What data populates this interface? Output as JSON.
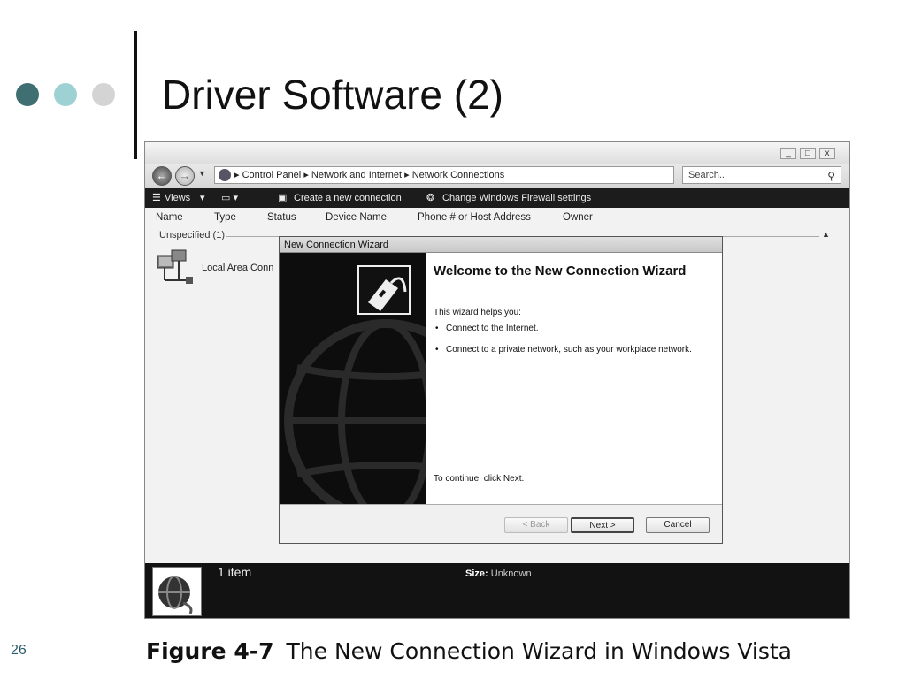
{
  "slide": {
    "title": "Driver Software (2)",
    "number": "26",
    "caption_label": "Figure 4-7",
    "caption_text": "The New Connection Wizard in Windows Vista"
  },
  "window": {
    "controls": {
      "minimize": "_",
      "maximize": "□",
      "close": "x"
    },
    "nav": {
      "back": "←",
      "forward": "→"
    },
    "breadcrumb": [
      "Control Panel",
      "Network and Internet",
      "Network Connections"
    ],
    "breadcrumb_sep": "▸",
    "search_placeholder": "Search...",
    "toolbar": {
      "views": "Views",
      "create_connection": "Create a new connection",
      "firewall": "Change Windows Firewall settings"
    },
    "columns": [
      "Name",
      "Type",
      "Status",
      "Device Name",
      "Phone # or Host Address",
      "Owner"
    ],
    "group_label": "Unspecified (1)",
    "item_label": "Local Area Conn",
    "status": {
      "count": "1 item",
      "size_label": "Size:",
      "size_value": "Unknown"
    }
  },
  "wizard": {
    "title": "New Connection Wizard",
    "heading": "Welcome to the New Connection Wizard",
    "intro": "This wizard helps you:",
    "bullets": [
      "Connect to the Internet.",
      "Connect to a private network, such as your workplace network."
    ],
    "continue_text": "To continue, click Next.",
    "buttons": {
      "back": "< Back",
      "next": "Next >",
      "cancel": "Cancel"
    }
  }
}
